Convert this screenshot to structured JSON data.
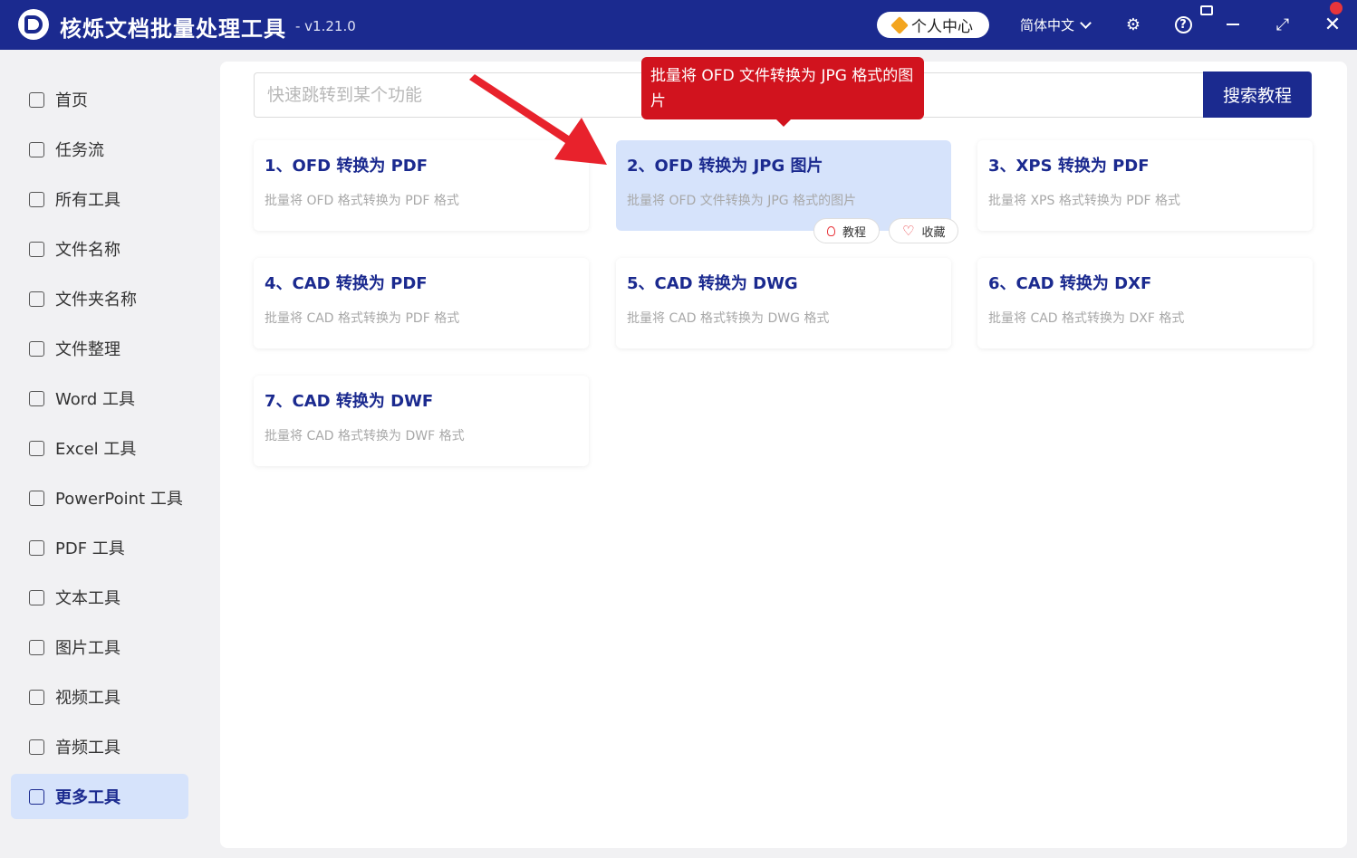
{
  "titlebar": {
    "app_title": "核烁文档批量处理工具",
    "version": "- v1.21.0",
    "user_center": "个人中心",
    "language": "简体中文",
    "icons": [
      "gear-icon",
      "help-icon",
      "minimize-icon",
      "maximize-icon",
      "close-icon"
    ]
  },
  "sidebar": {
    "items": [
      {
        "label": "首页",
        "icon": "home-icon"
      },
      {
        "label": "任务流",
        "icon": "workflow-icon"
      },
      {
        "label": "所有工具",
        "icon": "monitor-icon"
      },
      {
        "label": "文件名称",
        "icon": "file-icon"
      },
      {
        "label": "文件夹名称",
        "icon": "folder-icon"
      },
      {
        "label": "文件整理",
        "icon": "organize-icon"
      },
      {
        "label": "Word 工具",
        "icon": "word-icon"
      },
      {
        "label": "Excel 工具",
        "icon": "excel-icon"
      },
      {
        "label": "PowerPoint 工具",
        "icon": "powerpoint-icon"
      },
      {
        "label": "PDF 工具",
        "icon": "pdf-icon"
      },
      {
        "label": "文本工具",
        "icon": "text-icon"
      },
      {
        "label": "图片工具",
        "icon": "image-icon"
      },
      {
        "label": "视频工具",
        "icon": "video-icon"
      },
      {
        "label": "音频工具",
        "icon": "mic-icon"
      },
      {
        "label": "更多工具",
        "icon": "grid-icon",
        "active": true
      }
    ]
  },
  "search": {
    "placeholder": "快速跳转到某个功能",
    "button": "搜索教程"
  },
  "tooltip": "批量将 OFD 文件转换为 JPG 格式的图片",
  "cards": [
    {
      "title": "1、OFD 转换为 PDF",
      "desc": "批量将 OFD 格式转换为 PDF 格式"
    },
    {
      "title": "2、OFD 转换为 JPG 图片",
      "desc": "批量将 OFD 文件转换为 JPG 格式的图片",
      "hover": true
    },
    {
      "title": "3、XPS 转换为 PDF",
      "desc": "批量将 XPS 格式转换为 PDF 格式"
    },
    {
      "title": "4、CAD 转换为 PDF",
      "desc": "批量将 CAD 格式转换为 PDF 格式"
    },
    {
      "title": "5、CAD 转换为 DWG",
      "desc": "批量将 CAD 格式转换为 DWG 格式"
    },
    {
      "title": "6、CAD 转换为 DXF",
      "desc": "批量将 CAD 格式转换为 DXF 格式"
    },
    {
      "title": "7、CAD 转换为 DWF",
      "desc": "批量将 CAD 格式转换为 DWF 格式"
    }
  ],
  "card_actions": {
    "tutorial": "教程",
    "favorite": "收藏"
  },
  "colors": {
    "brand": "#1b2a8f",
    "accent_red": "#d1131e",
    "active_bg": "#d6e3fb"
  }
}
